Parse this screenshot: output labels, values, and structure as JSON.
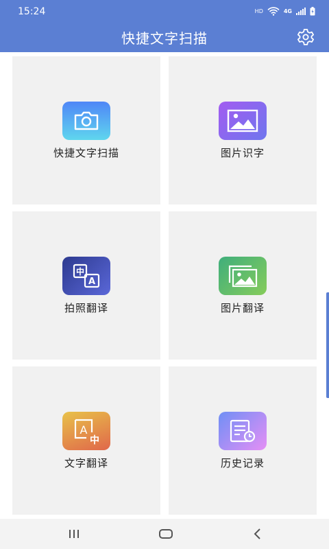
{
  "status_bar": {
    "time": "15:24",
    "hd": "HD",
    "network": "4G"
  },
  "header": {
    "title": "快捷文字扫描",
    "settings_icon": "gear-icon"
  },
  "tiles": [
    {
      "label": "快捷文字扫描",
      "icon": "camera-icon",
      "colors": [
        "#4f86f7",
        "#5fd6ee"
      ]
    },
    {
      "label": "图片识字",
      "icon": "image-icon",
      "colors": [
        "#a25cf0",
        "#6f76ee"
      ]
    },
    {
      "label": "拍照翻译",
      "icon": "photo-translate-icon",
      "colors": [
        "#2d3a8f",
        "#5a67d8"
      ]
    },
    {
      "label": "图片翻译",
      "icon": "image-translate-icon",
      "colors": [
        "#3fae7c",
        "#86cc5a"
      ]
    },
    {
      "label": "文字翻译",
      "icon": "text-translate-icon",
      "colors": [
        "#e8c24a",
        "#e0674a"
      ]
    },
    {
      "label": "历史记录",
      "icon": "history-icon",
      "colors": [
        "#6f8ff5",
        "#e58ff5"
      ]
    }
  ],
  "nav_bar": {
    "recents_icon": "recents-icon",
    "home_icon": "home-icon",
    "back_icon": "back-icon"
  },
  "colors": {
    "accent": "#5b7fd3",
    "tile_bg": "#f1f1f1"
  }
}
